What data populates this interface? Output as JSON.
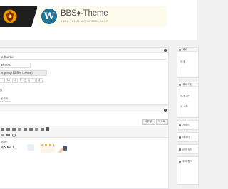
{
  "brand": {
    "logo_letter": "W",
    "title": "BBS♦-Theme",
    "subtitle": "BBS-E THEME WORDPRESS SHOP"
  },
  "form": {
    "field1_value": "e theme",
    "field2_value": "theme",
    "field3_value": "e,p,exp BBS-e theme)",
    "row_labels": [
      "50",
      "50",
      "3",
      "인",
      "세"
    ],
    "lower_label": "음",
    "select_value": "본선택"
  },
  "editor": {
    "tab_visual": "비주얼",
    "tab_text": "텍스트",
    "content_line1": "eme",
    "content_line2": "비스 No.1"
  },
  "sidebar": {
    "box1_title": "게시",
    "box1_text": "공개",
    "box2_title": "게시 기간",
    "box2_line1": "공개 기간",
    "box2_line2": "새 시작",
    "box3_title": "서비스",
    "box4_title": "데이터",
    "box5_title": "분류 설정",
    "box6_title": "추가 항목"
  },
  "colors": {
    "header_dark": "#1e1e1e",
    "banner_bg": "#fdfbec",
    "wordpress_blue": "#21759b",
    "page_bg": "#f1f1f1"
  },
  "icons": [
    "shield-emblem-icon",
    "wordpress-logo-icon",
    "gear-icon",
    "bold-icon",
    "italic-icon",
    "list-icon",
    "link-icon",
    "fullscreen-icon",
    "undo-icon",
    "help-icon"
  ]
}
